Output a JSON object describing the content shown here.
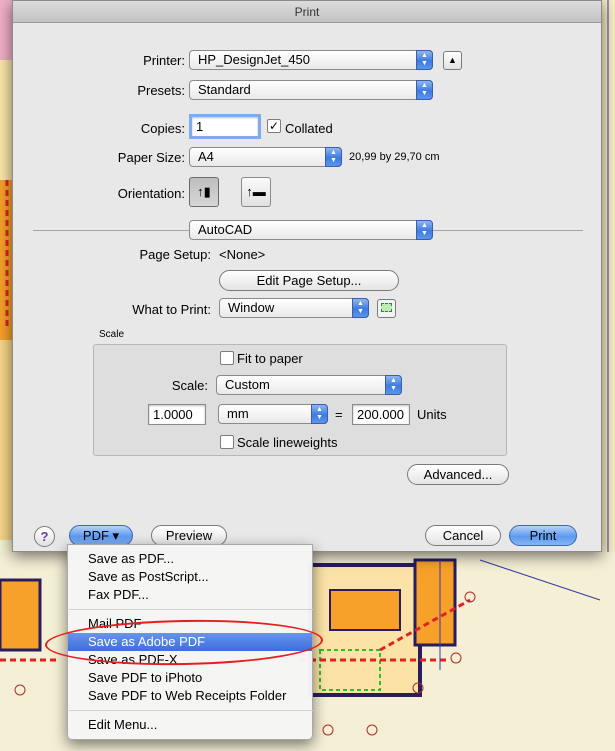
{
  "dialog": {
    "title": "Print"
  },
  "printer": {
    "label": "Printer:",
    "value": "HP_DesignJet_450"
  },
  "presets": {
    "label": "Presets:",
    "value": "Standard"
  },
  "copies": {
    "label": "Copies:",
    "value": "1",
    "collated_label": "Collated",
    "collated": true
  },
  "paper_size": {
    "label": "Paper Size:",
    "value": "A4",
    "dimensions": "20,99 by 29,70 cm"
  },
  "orientation": {
    "label": "Orientation:"
  },
  "section_popup": {
    "value": "AutoCAD"
  },
  "page_setup": {
    "label": "Page Setup:",
    "value": "<None>",
    "edit_button": "Edit Page Setup..."
  },
  "what_to_print": {
    "label": "What to Print:",
    "value": "Window"
  },
  "scale_group": {
    "title": "Scale",
    "fit_to_paper": "Fit to paper",
    "scale_label": "Scale:",
    "scale_value": "Custom",
    "ratio_left": "1.0000",
    "units_popup": "mm",
    "equals": "=",
    "ratio_right": "200.000",
    "units_label": "Units",
    "scale_lineweights": "Scale lineweights"
  },
  "advanced_button": "Advanced...",
  "footer": {
    "help": "?",
    "pdf": "PDF ▾",
    "preview": "Preview",
    "cancel": "Cancel",
    "print": "Print"
  },
  "pdf_menu": {
    "group1": [
      "Save as PDF...",
      "Save as PostScript...",
      "Fax PDF..."
    ],
    "group2": [
      "Mail PDF",
      "Save as Adobe PDF",
      "Save as PDF-X",
      "Save PDF to iPhoto",
      "Save PDF to Web Receipts Folder"
    ],
    "group3": [
      "Edit Menu..."
    ],
    "highlighted": "Save as Adobe PDF"
  },
  "colors": {
    "accent": "#3b6fdc",
    "annotation": "#e51f1f",
    "cad_orange": "#f7a02a",
    "cad_red": "#e02222"
  }
}
